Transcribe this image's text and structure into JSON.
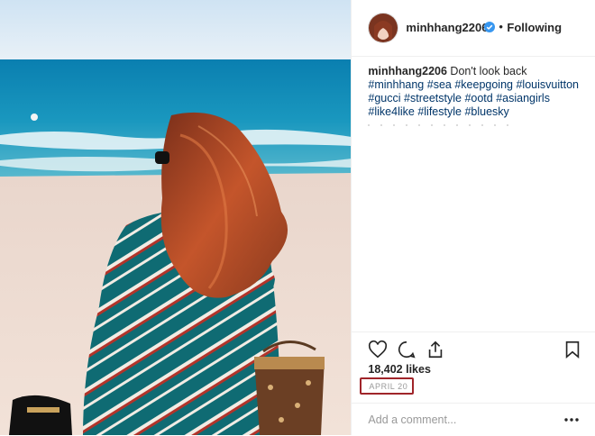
{
  "post": {
    "username": "minhhang2206",
    "separator": "•",
    "follow_status": "Following",
    "verified": true,
    "caption": {
      "username": "minhhang2206",
      "text": "Don't look back",
      "hashtags": [
        "#minhhang",
        "#sea",
        "#keepgoing",
        "#louisvuitton",
        "#gucci",
        "#streetstyle",
        "#ootd",
        "#asiangirls",
        "#like4like",
        "#lifestyle",
        "#bluesky"
      ]
    },
    "likes": "18,402 likes",
    "date": "APRIL 20",
    "comment": {
      "placeholder": "Add a comment..."
    }
  },
  "icons": {
    "like": "heart-icon",
    "comment": "comment-icon",
    "share": "share-icon",
    "save": "bookmark-icon",
    "more": "more-options-icon",
    "verified": "verified-badge-icon"
  },
  "colors": {
    "hashtag": "#003569",
    "verified": "#3897f0",
    "date_highlight": "#a0252a",
    "text": "#262626",
    "muted": "#999999"
  }
}
